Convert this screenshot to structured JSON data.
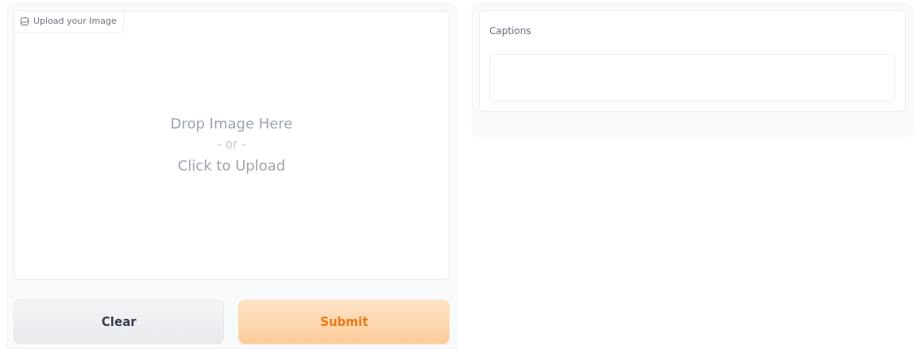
{
  "image_input": {
    "label": "Upload your Image",
    "drop_text": "Drop Image Here",
    "separator": "- or -",
    "click_text": "Click to Upload"
  },
  "buttons": [
    {
      "label": "Clear",
      "kind": "secondary"
    },
    {
      "label": "Submit",
      "kind": "primary"
    }
  ],
  "output": {
    "label": "Captions"
  }
}
